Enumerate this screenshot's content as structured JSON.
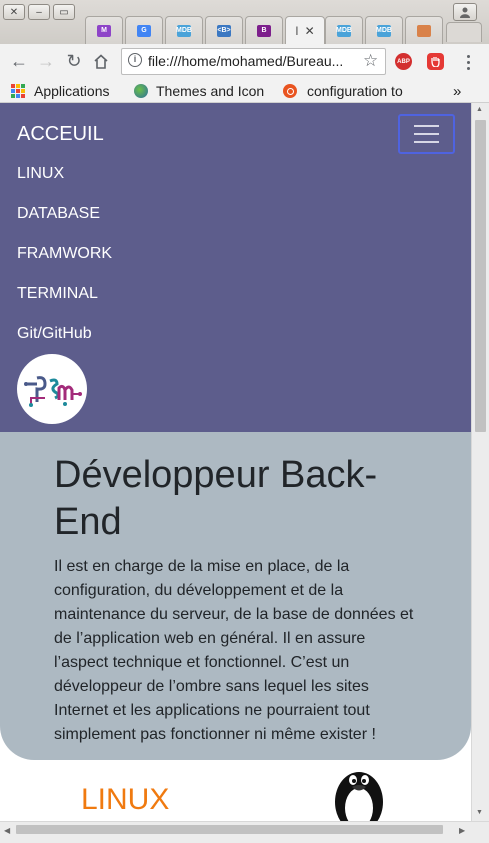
{
  "browser": {
    "address_url": "file:///home/mohamed/Bureau...",
    "tabs": [
      {
        "name": "tab-gmail",
        "label": "M",
        "color": "#8e44c8"
      },
      {
        "name": "tab-google",
        "label": "G",
        "color": "#4285f4"
      },
      {
        "name": "tab-mdb-1",
        "label": "MDB",
        "color": "#4aa3d9"
      },
      {
        "name": "tab-bootstrap-1",
        "label": "<B>",
        "color": "#3b78c2"
      },
      {
        "name": "tab-bootstrap-2",
        "label": "B",
        "color": "#7d1f8c"
      },
      {
        "name": "tab-mdb-2",
        "label": "MDB",
        "color": "#4aa3d9"
      },
      {
        "name": "tab-mdb-3",
        "label": "MDB",
        "color": "#4aa3d9"
      },
      {
        "name": "tab-cookie",
        "label": "",
        "color": "#d9824a"
      }
    ],
    "active_tab_label": "I",
    "active_tab_close": "✕",
    "bookmarks": [
      {
        "name": "bookmark-applications",
        "label": "Applications"
      },
      {
        "name": "bookmark-themes",
        "label": "Themes and Icon"
      },
      {
        "name": "bookmark-configuration",
        "label": "configuration to"
      }
    ],
    "bookmarks_overflow": "»",
    "extension_abp": "ABP"
  },
  "site": {
    "brand": "ACCEUIL",
    "nav_links": [
      "LINUX",
      "DATABASE",
      "FRAMWORK",
      "TERMINAL",
      "Git/GitHub"
    ],
    "logo_text": "Ps m",
    "hero_title": "Développeur Back-End",
    "hero_text": "Il est en charge de la mise en place, de la configuration, du développement et de la maintenance du serveur, de la base de données et de l’application web en général. Il en assure l’aspect technique et fonctionnel. C’est un développeur de l’ombre sans lequel les sites Internet et les applications ne pourraient tout simplement pas fonctionner ni même exister !",
    "section_title": "LINUX"
  },
  "colors": {
    "navbar_bg": "#5d5d8c",
    "hero_bg": "#adb9c2",
    "section_title": "#f07a10",
    "toggler_border": "#4f63e0"
  }
}
